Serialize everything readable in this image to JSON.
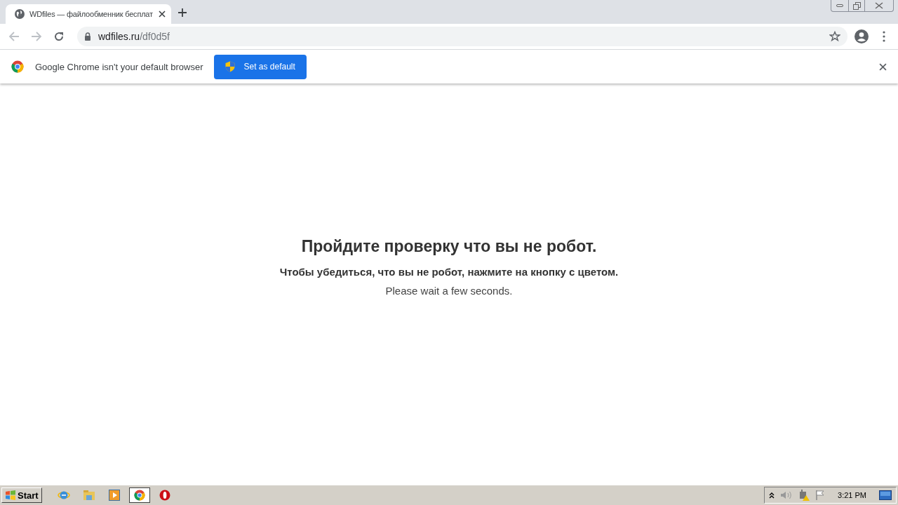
{
  "tab": {
    "title": "WDfiles — файлообменник бесплат"
  },
  "address": {
    "host": "wdfiles.ru",
    "path": "/df0d5f"
  },
  "infobar": {
    "message": "Google Chrome isn't your default browser",
    "button": "Set as default"
  },
  "page": {
    "heading": "Пройдите проверку что вы не робот.",
    "instruction": "Чтобы убедиться, что вы не робот, нажмите на кнопку с цветом.",
    "note": "Please wait a few seconds."
  },
  "taskbar": {
    "start": "Start",
    "apps": [
      {
        "kind": "ie",
        "selected": false
      },
      {
        "kind": "folder",
        "selected": false
      },
      {
        "kind": "media",
        "selected": false
      },
      {
        "kind": "chrome",
        "selected": true
      },
      {
        "kind": "opera",
        "selected": false
      }
    ],
    "clock": "3:21 PM"
  }
}
